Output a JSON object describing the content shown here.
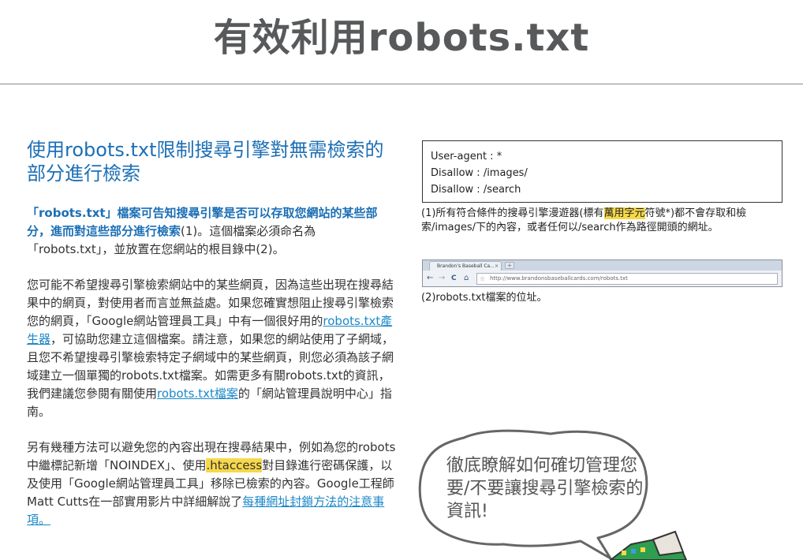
{
  "page": {
    "title": "有效利用robots.txt"
  },
  "section": {
    "heading": "使用robots.txt限制搜尋引擎對無需檢索的部分進行檢索",
    "p1_bold": "「robots.txt」檔案可告知搜尋引擎是否可以存取您網站的某些部分，進而對這些部分進行檢索",
    "p1_rest": "(1)。這個檔案必須命名為「robots.txt」，並放置在您網站的根目錄中(2)。",
    "p2_a": "您可能不希望搜尋引擎檢索網站中的某些網頁，因為這些出現在搜尋結果中的網頁，對使用者而言並無益處。如果您確實想阻止搜尋引擎檢索您的網頁，「Google網站管理員工具」中有一個很好用的",
    "p2_link1": "robots.txt產生器",
    "p2_b": "，可協助您建立這個檔案。請注意，如果您的網站使用了子網域，且您不希望搜尋引擎檢索特定子網域中的某些網頁，則您必須為該子網域建立一個單獨的robots.txt檔案。如需更多有關robots.txt的資訊，我們建議您參閱有關使用",
    "p2_link2": "robots.txt檔案",
    "p2_c": "的「網站管理員說明中心」指南。",
    "p3_a": "另有幾種方法可以避免您的內容出現在搜尋結果中，例如為您的robots中繼標記新增「NOINDEX」、使用",
    "p3_hl": ".htaccess",
    "p3_b": "對目錄進行密碼保護，以及使用「Google網站管理員工具」移除已檢索的內容。Google工程師Matt Cutts在一部實用影片中詳細解說了",
    "p3_link": "每種網址封鎖方法的注意事項。"
  },
  "code_example": {
    "lines": [
      "User-agent : *",
      "Disallow : /images/",
      "Disallow : /search"
    ]
  },
  "caption1": {
    "a": "(1)所有符合條件的搜尋引擎漫遊器(標有",
    "hl": "萬用字元",
    "b": "符號*)都不會存取和檢索/images/下的內容，或者任何以/search作為路徑開頭的網址。"
  },
  "browser": {
    "tab_title": "Brandon's Baseball Ca...",
    "tab_close": "×",
    "new_tab": "+",
    "back": "←",
    "forward": "→",
    "reload": "C",
    "home": "⌂",
    "star": "☆",
    "url": "http://www.brandonsbaseballcards.com/robots.txt"
  },
  "caption2": "(2)robots.txt檔案的位址。",
  "bubble": {
    "text": "徹底瞭解如何確切管理您要/不要讓搜尋引擎檢索的資訊!"
  },
  "colors": {
    "heading_blue": "#1c6fb5",
    "link_blue": "#1c88c8",
    "highlight": "#f6d84a",
    "title_gray": "#58595b"
  }
}
